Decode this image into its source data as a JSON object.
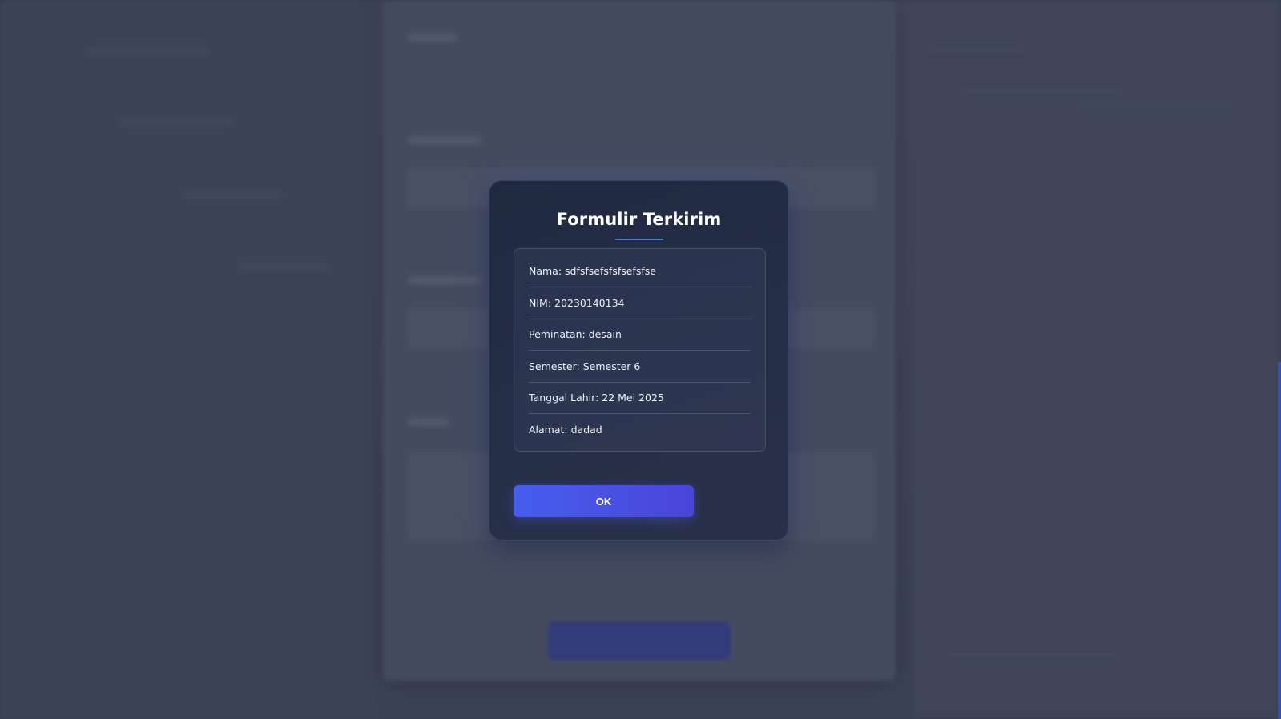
{
  "modal": {
    "title": "Formulir Terkirim",
    "rows": [
      "Nama: sdfsfsefsfsfsefsfse",
      "NIM: 20230140134",
      "Peminatan: desain",
      "Semester: Semester 6",
      "Tanggal Lahir: 22 Mei 2025",
      "Alamat: dadad"
    ],
    "ok_label": "OK"
  },
  "colors": {
    "accent": "#465ef0",
    "underline": "#3f7bf0",
    "modal_bg": "#232c44"
  }
}
